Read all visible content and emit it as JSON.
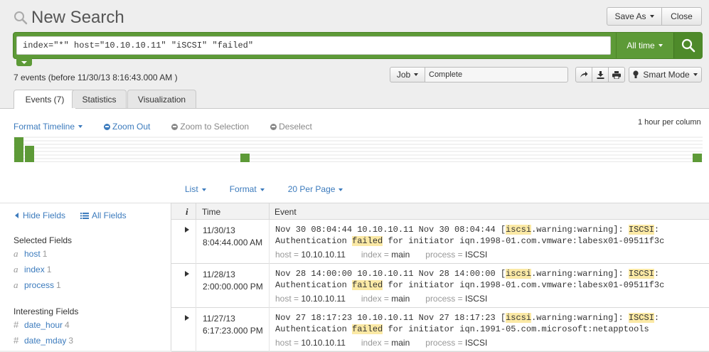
{
  "header": {
    "title": "New Search",
    "save_as_label": "Save As",
    "close_label": "Close"
  },
  "search": {
    "query": "index=\"*\" host=\"10.10.10.11\" \"iSCSI\" \"failed\"",
    "time_range": "All time"
  },
  "status": {
    "event_count": "7 events (before 11/30/13 8:16:43.000 AM )",
    "job_label": "Job",
    "job_status": "Complete",
    "mode_label": "Smart Mode"
  },
  "tabs": [
    {
      "label": "Events (7)",
      "active": true
    },
    {
      "label": "Statistics",
      "active": false
    },
    {
      "label": "Visualization",
      "active": false
    }
  ],
  "timeline": {
    "format_label": "Format Timeline",
    "zoom_out_label": "Zoom Out",
    "zoom_selection_label": "Zoom to Selection",
    "deselect_label": "Deselect",
    "scale_label": "1 hour per column",
    "bar_color": "#5d9a37"
  },
  "list_controls": {
    "list_label": "List",
    "format_label": "Format",
    "per_page_label": "20 Per Page"
  },
  "sidebar": {
    "hide_fields_label": "Hide Fields",
    "all_fields_label": "All Fields",
    "selected_heading": "Selected Fields",
    "selected_fields": [
      {
        "type": "a",
        "name": "host",
        "count": "1"
      },
      {
        "type": "a",
        "name": "index",
        "count": "1"
      },
      {
        "type": "a",
        "name": "process",
        "count": "1"
      }
    ],
    "interesting_heading": "Interesting Fields",
    "interesting_fields": [
      {
        "type": "#",
        "name": "date_hour",
        "count": "4"
      },
      {
        "type": "#",
        "name": "date_mday",
        "count": "3"
      }
    ]
  },
  "table": {
    "info_header": "i",
    "time_header": "Time",
    "event_header": "Event",
    "rows": [
      {
        "date": "11/30/13",
        "time": "8:04:44.000 AM",
        "line1_pre": "Nov 30 08:04:44 10.10.10.11 Nov 30 08:04:44 [",
        "line1_hl1": "iscsi",
        "line1_mid": ".warning:warning]: ",
        "line1_hl2": "ISCSI",
        "line1_post": ":",
        "line2_pre": "Authentication ",
        "line2_hl": "failed",
        "line2_post": " for initiator iqn.1998-01.com.vmware:labesx01-09511f3c",
        "host": "10.10.10.11",
        "index": "main",
        "process": "ISCSI"
      },
      {
        "date": "11/28/13",
        "time": "2:00:00.000 PM",
        "line1_pre": "Nov 28 14:00:00 10.10.10.11 Nov 28 14:00:00 [",
        "line1_hl1": "iscsi",
        "line1_mid": ".warning:warning]: ",
        "line1_hl2": "ISCSI",
        "line1_post": ":",
        "line2_pre": "Authentication ",
        "line2_hl": "failed",
        "line2_post": " for initiator iqn.1998-01.com.vmware:labesx01-09511f3c",
        "host": "10.10.10.11",
        "index": "main",
        "process": "ISCSI"
      },
      {
        "date": "11/27/13",
        "time": "6:17:23.000 PM",
        "line1_pre": "Nov 27 18:17:23 10.10.10.11 Nov 27 18:17:23 [",
        "line1_hl1": "iscsi",
        "line1_mid": ".warning:warning]: ",
        "line1_hl2": "ISCSI",
        "line1_post": ":",
        "line2_pre": "Authentication ",
        "line2_hl": "failed",
        "line2_post": " for initiator iqn.1991-05.com.microsoft:netapptools",
        "host": "10.10.10.11",
        "index": "main",
        "process": "ISCSI"
      }
    ],
    "meta_labels": {
      "host": "host = ",
      "index": "index = ",
      "process": "process = "
    }
  }
}
